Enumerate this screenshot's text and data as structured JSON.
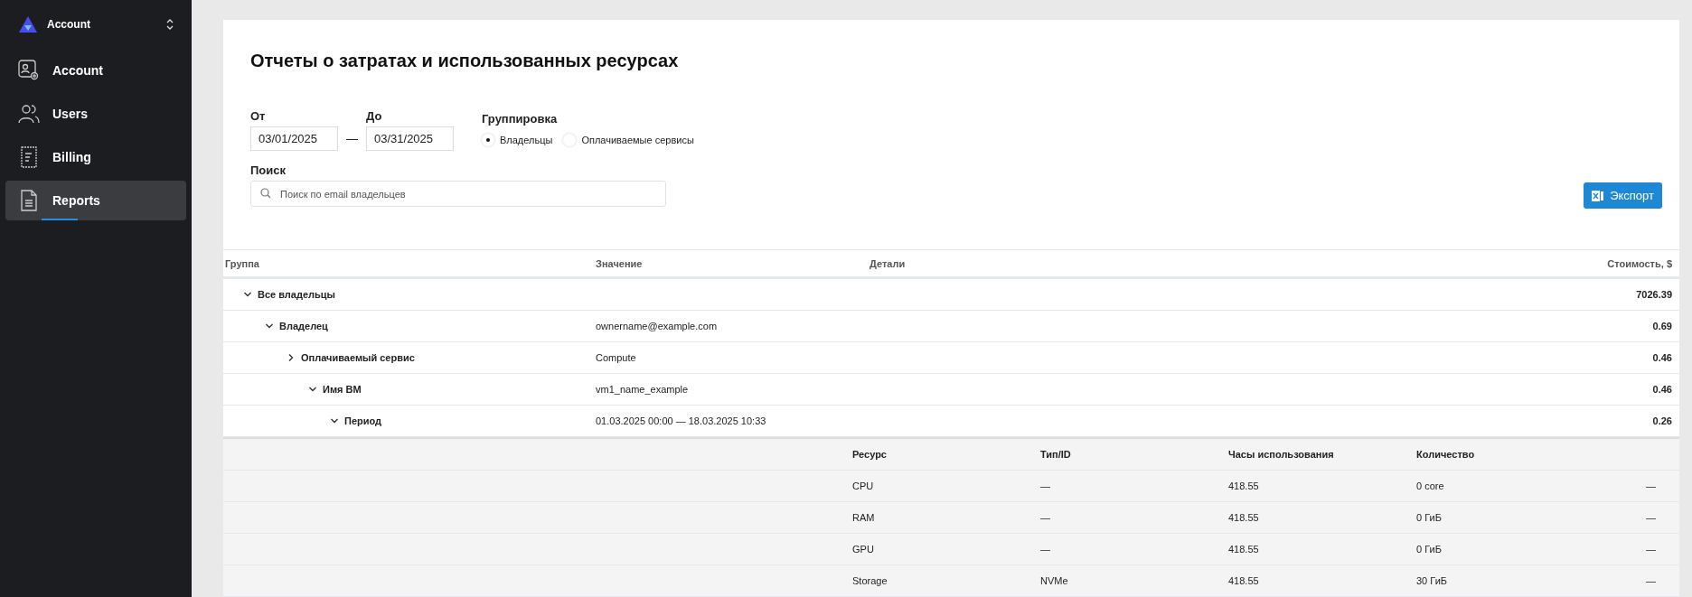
{
  "sidebar": {
    "header": {
      "title": "Account"
    },
    "items": [
      {
        "label": "Account",
        "kind": "account-settings",
        "selected": false
      },
      {
        "label": "Users",
        "kind": "users",
        "selected": false
      },
      {
        "label": "Billing",
        "kind": "billing",
        "selected": false
      },
      {
        "label": "Reports",
        "kind": "reports",
        "selected": true
      }
    ]
  },
  "page": {
    "title": "Отчеты о затратах и использованных ресурсах",
    "from": {
      "label": "От",
      "value": "03/01/2025"
    },
    "separator": "—",
    "to": {
      "label": "До",
      "value": "03/31/2025"
    },
    "grouping": {
      "label": "Группировка",
      "options": [
        {
          "label": "Владельцы",
          "selected": true
        },
        {
          "label": "Оплачиваемые сервисы",
          "selected": false
        }
      ]
    },
    "search": {
      "label": "Поиск",
      "placeholder": "Поиск по email владельцев"
    },
    "export_button": "Экспорт"
  },
  "table": {
    "columns": [
      "Группа",
      "Значение",
      "Детали",
      "Стоимость, $"
    ],
    "rows": [
      {
        "group": "Все владельцы",
        "value": "",
        "cost": "7026.39",
        "expanded": true,
        "children": [
          {
            "group": "Владелец",
            "value": "ownername@example.com",
            "cost": "0.69",
            "expanded": true,
            "children": [
              {
                "group": "Оплачиваемый сервис",
                "value": "Compute",
                "cost": "0.46",
                "expanded": false,
                "children": [
                  {
                    "group": "Имя ВМ",
                    "value": "vm1_name_example",
                    "cost": "0.46",
                    "expanded": true,
                    "children": [
                      {
                        "group": "Период",
                        "value": "01.03.2025 00:00 — 18.03.2025 10:33",
                        "cost": "0.26",
                        "expanded": true
                      }
                    ]
                  }
                ]
              }
            ]
          }
        ]
      }
    ],
    "resources": {
      "columns": [
        "Ресурс",
        "Тип/ID",
        "Часы использования",
        "Количество"
      ],
      "rows": [
        {
          "resource": "CPU",
          "type_id": "—",
          "hours": "418.55",
          "quantity": "0 core",
          "column_5": "—"
        },
        {
          "resource": "RAM",
          "type_id": "—",
          "hours": "418.55",
          "quantity": "0 ГиБ",
          "column_5": "—"
        },
        {
          "resource": "GPU",
          "type_id": "—",
          "hours": "418.55",
          "quantity": "0 ГиБ",
          "column_5": "—"
        },
        {
          "resource": "Storage",
          "type_id": "NVMe",
          "hours": "418.55",
          "quantity": "30 ГиБ",
          "column_5": "—"
        }
      ]
    }
  }
}
